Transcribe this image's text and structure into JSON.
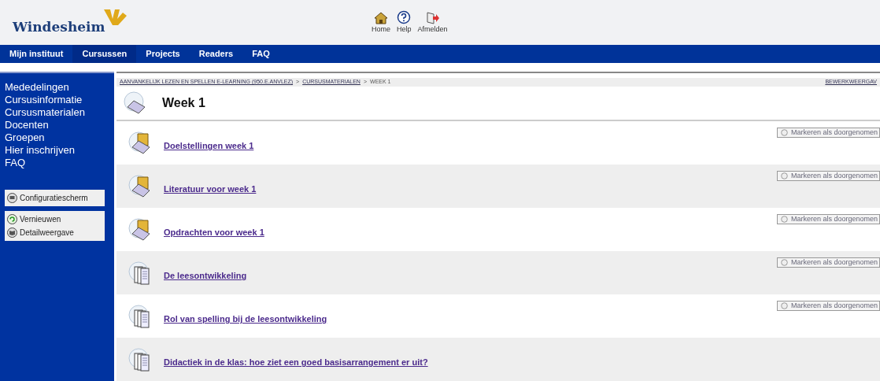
{
  "header": {
    "logo": "Windesheim",
    "links": [
      {
        "kind": "home",
        "label": "Home"
      },
      {
        "kind": "help",
        "label": "Help"
      },
      {
        "kind": "logout",
        "label": "Afmelden"
      }
    ]
  },
  "nav": {
    "tabs": [
      {
        "label": "Mijn instituut",
        "selected": false
      },
      {
        "label": "Cursussen",
        "selected": true
      },
      {
        "label": "Projects",
        "selected": false
      },
      {
        "label": "Readers",
        "selected": false
      },
      {
        "label": "FAQ",
        "selected": false
      }
    ]
  },
  "sidebar": {
    "items": [
      "Mededelingen",
      "Cursusinformatie",
      "Cursusmaterialen",
      "Docenten",
      "Groepen",
      "Hier inschrijven",
      "FAQ"
    ],
    "tools": [
      [
        {
          "kind": "config",
          "label": "Configuratiescherm"
        }
      ],
      [
        {
          "kind": "refresh",
          "label": "Vernieuwen"
        },
        {
          "kind": "detail",
          "label": "Detailweergave"
        }
      ]
    ]
  },
  "breadcrumb": {
    "items": [
      {
        "label": "AANVANKELIJK LEZEN EN SPELLEN E-LEARNING (950.E.ANVLEZ)",
        "link": true
      },
      {
        "label": "CURSUSMATERIALEN",
        "link": true
      },
      {
        "label": "WEEK 1",
        "link": false
      }
    ],
    "separator": ">",
    "edit_link": "BEWERKWEERGAV"
  },
  "page_title": "Week 1",
  "items": [
    {
      "kind": "folder",
      "title": "Doelstellingen week 1",
      "mark_button": "Markeren als doorgenomen"
    },
    {
      "kind": "folder",
      "title": "Literatuur voor week 1",
      "mark_button": "Markeren als doorgenomen"
    },
    {
      "kind": "folder",
      "title": "Opdrachten voor week 1",
      "mark_button": "Markeren als doorgenomen"
    },
    {
      "kind": "document",
      "title": "De leesontwikkeling",
      "mark_button": "Markeren als doorgenomen"
    },
    {
      "kind": "document",
      "title": "Rol van spelling bij de leesontwikkeling",
      "mark_button": "Markeren als doorgenomen"
    },
    {
      "kind": "document",
      "title": "Didactiek in de klas: hoe ziet een goed basisarrangement er uit?"
    }
  ]
}
